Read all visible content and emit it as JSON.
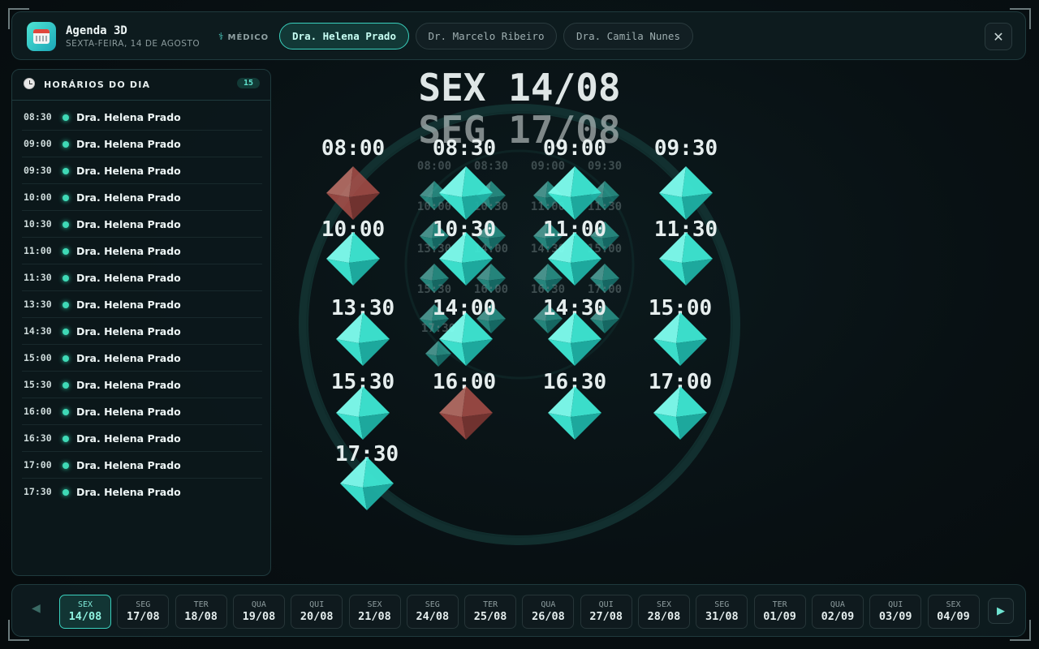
{
  "app": {
    "title": "Agenda 3D",
    "date": "SEXTA-FEIRA, 14 DE AGOSTO"
  },
  "doctor_filter": {
    "label": "MÉDICO",
    "options": [
      "Dra. Helena Prado",
      "Dr. Marcelo Ribeiro",
      "Dra. Camila Nunes"
    ],
    "selected": "Dra. Helena Prado"
  },
  "panel": {
    "title": "HORÁRIOS DO DIA",
    "count": "15",
    "slots": [
      {
        "time": "08:30",
        "doctor": "Dra. Helena Prado"
      },
      {
        "time": "09:00",
        "doctor": "Dra. Helena Prado"
      },
      {
        "time": "09:30",
        "doctor": "Dra. Helena Prado"
      },
      {
        "time": "10:00",
        "doctor": "Dra. Helena Prado"
      },
      {
        "time": "10:30",
        "doctor": "Dra. Helena Prado"
      },
      {
        "time": "11:00",
        "doctor": "Dra. Helena Prado"
      },
      {
        "time": "11:30",
        "doctor": "Dra. Helena Prado"
      },
      {
        "time": "13:30",
        "doctor": "Dra. Helena Prado"
      },
      {
        "time": "14:30",
        "doctor": "Dra. Helena Prado"
      },
      {
        "time": "15:00",
        "doctor": "Dra. Helena Prado"
      },
      {
        "time": "15:30",
        "doctor": "Dra. Helena Prado"
      },
      {
        "time": "16:00",
        "doctor": "Dra. Helena Prado"
      },
      {
        "time": "16:30",
        "doctor": "Dra. Helena Prado"
      },
      {
        "time": "17:00",
        "doctor": "Dra. Helena Prado"
      },
      {
        "time": "17:30",
        "doctor": "Dra. Helena Prado"
      }
    ]
  },
  "scene": {
    "front_title": "SEX 14/08",
    "back_title": "SEG 17/08",
    "front_times": [
      "08:00",
      "08:30",
      "09:00",
      "09:30",
      "10:00",
      "10:30",
      "11:00",
      "11:30",
      "13:30",
      "14:00",
      "14:30",
      "15:00",
      "15:30",
      "16:00",
      "16:30",
      "17:00",
      "17:30"
    ],
    "back_times": [
      "08:00",
      "08:30",
      "09:00",
      "09:30",
      "10:00",
      "10:30",
      "11:00",
      "11:30",
      "13:30",
      "14:00",
      "14:30",
      "15:00",
      "15:30",
      "16:00",
      "16:30",
      "17:00",
      "17:30"
    ],
    "colors": {
      "available": "#3ee8d4",
      "busy": "#b5524c",
      "ring": "#163a38"
    }
  },
  "date_strip": {
    "days": [
      {
        "weekday": "SEX",
        "date": "14/08"
      },
      {
        "weekday": "SEG",
        "date": "17/08"
      },
      {
        "weekday": "TER",
        "date": "18/08"
      },
      {
        "weekday": "QUA",
        "date": "19/08"
      },
      {
        "weekday": "QUI",
        "date": "20/08"
      },
      {
        "weekday": "SEX",
        "date": "21/08"
      },
      {
        "weekday": "SEG",
        "date": "24/08"
      },
      {
        "weekday": "TER",
        "date": "25/08"
      },
      {
        "weekday": "QUA",
        "date": "26/08"
      },
      {
        "weekday": "QUI",
        "date": "27/08"
      },
      {
        "weekday": "SEX",
        "date": "28/08"
      },
      {
        "weekday": "SEG",
        "date": "31/08"
      },
      {
        "weekday": "TER",
        "date": "01/09"
      },
      {
        "weekday": "QUA",
        "date": "02/09"
      },
      {
        "weekday": "QUI",
        "date": "03/09"
      },
      {
        "weekday": "SEX",
        "date": "04/09"
      }
    ],
    "selected": "14/08",
    "prev_icon": "triangle-left-icon",
    "next_icon": "triangle-right-icon"
  },
  "close_icon": "close-icon"
}
